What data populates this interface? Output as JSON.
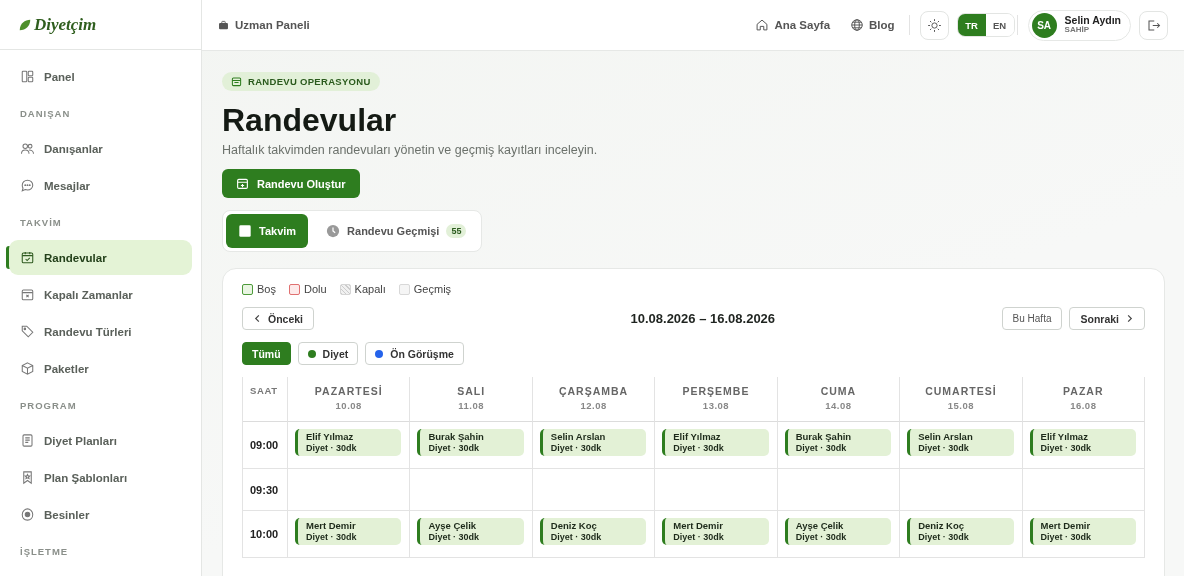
{
  "brand": {
    "logo_text": "Diyetçim"
  },
  "sidebar": {
    "items": [
      {
        "kind": "item",
        "label": "Panel",
        "selected": false
      },
      {
        "kind": "section",
        "label": "DANIŞAN"
      },
      {
        "kind": "item",
        "label": "Danışanlar",
        "selected": false
      },
      {
        "kind": "item",
        "label": "Mesajlar",
        "selected": false
      },
      {
        "kind": "section",
        "label": "TAKVİM"
      },
      {
        "kind": "item",
        "label": "Randevular",
        "selected": true
      },
      {
        "kind": "item",
        "label": "Kapalı Zamanlar",
        "selected": false
      },
      {
        "kind": "item",
        "label": "Randevu Türleri",
        "selected": false
      },
      {
        "kind": "item",
        "label": "Paketler",
        "selected": false
      },
      {
        "kind": "section",
        "label": "PROGRAM"
      },
      {
        "kind": "item",
        "label": "Diyet Planları",
        "selected": false
      },
      {
        "kind": "item",
        "label": "Plan Şablonları",
        "selected": false
      },
      {
        "kind": "item",
        "label": "Besinler",
        "selected": false
      },
      {
        "kind": "section",
        "label": "İŞLETME"
      }
    ]
  },
  "topbar": {
    "breadcrumb": "Uzman Paneli",
    "links": [
      {
        "label": "Ana Sayfa"
      },
      {
        "label": "Blog"
      }
    ],
    "languages": [
      {
        "label": "TR",
        "selected": true
      },
      {
        "label": "EN",
        "selected": false
      }
    ],
    "user": {
      "initials": "SA",
      "name": "Selin Aydın",
      "role": "SAHİP"
    }
  },
  "page": {
    "badge": "RANDEVU OPERASYONU",
    "title": "Randevular",
    "subtitle": "Haftalık takvimden randevuları yönetin ve geçmiş kayıtları inceleyin.",
    "create_button": "Randevu Oluştur",
    "tabs": [
      {
        "label": "Takvim",
        "selected": true
      },
      {
        "label": "Randevu Geçmişi",
        "selected": false,
        "count": "55"
      }
    ]
  },
  "calendar": {
    "legend": [
      {
        "kind": "free",
        "label": "Boş"
      },
      {
        "kind": "busy",
        "label": "Dolu"
      },
      {
        "kind": "closed",
        "label": "Kapalı"
      },
      {
        "kind": "past",
        "label": "Geçmiş"
      }
    ],
    "prev": "Önceki",
    "range": "10.08.2026 – 16.08.2026",
    "this_week": "Bu Hafta",
    "next": "Sonraki",
    "filters": [
      {
        "label": "Tümü",
        "selected": true
      },
      {
        "label": "Diyet",
        "selected": false,
        "color": "#2e7d1f"
      },
      {
        "label": "Ön Görüşme",
        "selected": false,
        "color": "#2563eb"
      }
    ],
    "time_header": "SAAT",
    "days": [
      {
        "name": "PAZARTESİ",
        "date": "10.08"
      },
      {
        "name": "SALI",
        "date": "11.08"
      },
      {
        "name": "ÇARŞAMBA",
        "date": "12.08"
      },
      {
        "name": "PERŞEMBE",
        "date": "13.08"
      },
      {
        "name": "CUMA",
        "date": "14.08"
      },
      {
        "name": "CUMARTESİ",
        "date": "15.08"
      },
      {
        "name": "PAZAR",
        "date": "16.08"
      }
    ],
    "rows": [
      {
        "time": "09:00",
        "slots": [
          {
            "name": "Elif Yılmaz",
            "detail": "Diyet · 30dk"
          },
          {
            "name": "Burak Şahin",
            "detail": "Diyet · 30dk"
          },
          {
            "name": "Selin Arslan",
            "detail": "Diyet · 30dk"
          },
          {
            "name": "Elif Yılmaz",
            "detail": "Diyet · 30dk"
          },
          {
            "name": "Burak Şahin",
            "detail": "Diyet · 30dk"
          },
          {
            "name": "Selin Arslan",
            "detail": "Diyet · 30dk"
          },
          {
            "name": "Elif Yılmaz",
            "detail": "Diyet · 30dk"
          }
        ]
      },
      {
        "time": "09:30"
      },
      {
        "time": "10:00",
        "slots": [
          {
            "name": "Mert Demir",
            "detail": "Diyet · 30dk"
          },
          {
            "name": "Ayşe Çelik",
            "detail": "Diyet · 30dk"
          },
          {
            "name": "Deniz Koç",
            "detail": "Diyet · 30dk"
          },
          {
            "name": "Mert Demir",
            "detail": "Diyet · 30dk"
          },
          {
            "name": "Ayşe Çelik",
            "detail": "Diyet · 30dk"
          },
          {
            "name": "Deniz Koç",
            "detail": "Diyet · 30dk"
          },
          {
            "name": "Mert Demir",
            "detail": "Diyet · 30dk"
          }
        ]
      }
    ]
  }
}
